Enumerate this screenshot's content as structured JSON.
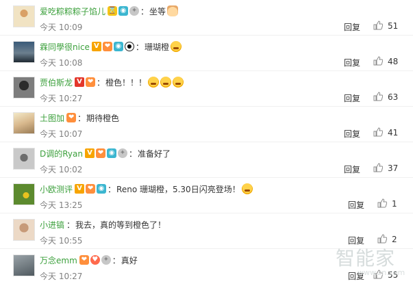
{
  "labels": {
    "reply": "回复"
  },
  "colors": {
    "username": "#3ca03c",
    "time": "#808080"
  },
  "watermark": {
    "logo": "智能家",
    "url": "www.zn.com"
  },
  "comments": [
    {
      "username": "爱吃粽粽粽子馅儿",
      "badges": [
        "hourglass-badge-icon",
        "camera-badge-icon",
        "star-badge-icon"
      ],
      "text": "坐等",
      "emojis": [
        "victory-hand-emoji"
      ],
      "time": "今天 10:09",
      "likes": "51"
    },
    {
      "username": "霖同學很nice",
      "badges": [
        "vip-badge-icon",
        "fans-badge-icon",
        "camera-badge-icon",
        "panda-badge-icon"
      ],
      "text": "珊瑚橙",
      "emojis": [
        "shocked-emoji"
      ],
      "time": "今天 10:08",
      "likes": "48"
    },
    {
      "username": "贾伯斯龙",
      "badges": [
        "vip-red-badge-icon",
        "fans-badge-icon"
      ],
      "text": "橙色！！！",
      "emojis": [
        "shocked-emoji",
        "shocked-emoji",
        "shocked-emoji"
      ],
      "time": "今天 10:27",
      "likes": "63"
    },
    {
      "username": "土图加",
      "badges": [
        "fans-badge-icon"
      ],
      "text": "期待橙色",
      "emojis": [],
      "time": "今天 10:07",
      "likes": "41"
    },
    {
      "username": "D调的Ryan",
      "badges": [
        "vip-badge-icon",
        "fans-badge-icon",
        "camera-badge-icon",
        "star-badge-icon"
      ],
      "text": "准备好了",
      "emojis": [],
      "time": "今天 10:02",
      "likes": "37"
    },
    {
      "username": "小欧测评",
      "badges": [
        "vip-badge-icon",
        "fans-badge-icon",
        "camera-badge-icon"
      ],
      "text": "Reno 珊瑚橙，5.30日闪亮登场！",
      "emojis": [
        "blush-emoji"
      ],
      "time": "今天 13:25",
      "likes": "1"
    },
    {
      "username": "小进镐",
      "badges": [],
      "text": "我去，真的等到橙色了！",
      "emojis": [],
      "time": "今天 10:55",
      "likes": "2"
    },
    {
      "username": "万念emm",
      "badges": [
        "fans-badge-icon",
        "heart-badge-icon",
        "star-badge-icon"
      ],
      "text": "真好",
      "emojis": [],
      "time": "今天 10:27",
      "likes": "55"
    }
  ]
}
